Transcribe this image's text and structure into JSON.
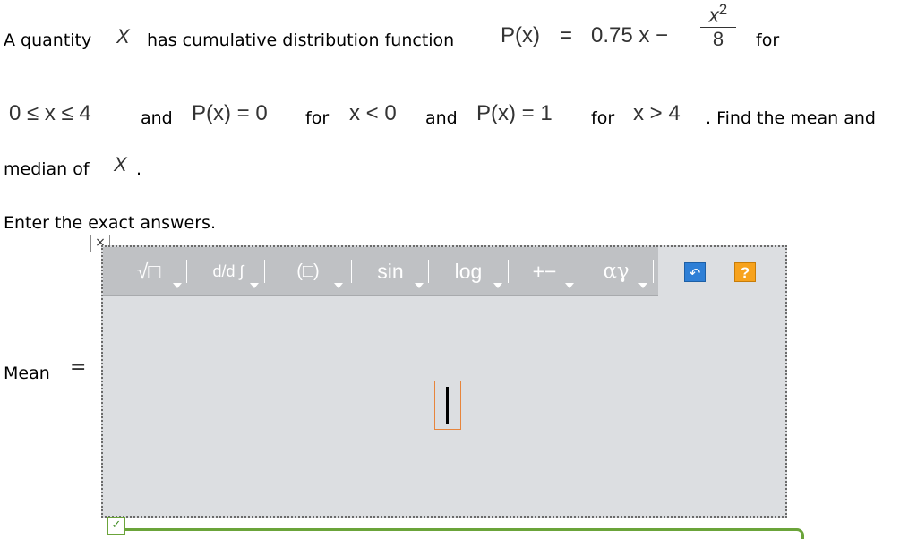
{
  "question": {
    "l1_a": "A quantity",
    "var_x": "X",
    "l1_b": "has cumulative distribution function",
    "cdf_lhs": "P(x)",
    "eq": "=",
    "cdf_rhs": "0.75 x −",
    "frac_num": "x",
    "frac_exp": "2",
    "frac_den": "8",
    "for1": "for",
    "range": "0 ≤ x ≤ 4",
    "and1": "and",
    "cond2": "P(x) = 0",
    "for2": "for",
    "cond2_range": "x < 0",
    "and2": "and",
    "cond3": "P(x) = 1",
    "for3": "for",
    "cond3_range": "x > 4",
    "l2_end": ". Find the mean and",
    "l3_a": "median of",
    "l3_end": "."
  },
  "instruction": "Enter the exact answers.",
  "answer": {
    "label": "Mean",
    "equals": "="
  },
  "editor": {
    "close_glyph": "×",
    "toolbar": [
      {
        "name": "radical-button",
        "label": "√□"
      },
      {
        "name": "calculus-button",
        "label": "d/d ∫"
      },
      {
        "name": "parentheses-button",
        "label": "(□)"
      },
      {
        "name": "trig-button",
        "label": "sin"
      },
      {
        "name": "log-button",
        "label": "log"
      },
      {
        "name": "operators-button",
        "label": "+−"
      },
      {
        "name": "greek-button",
        "label": "αγ"
      }
    ],
    "undo_glyph": "↶",
    "help_glyph": "?",
    "check_glyph": "✓"
  },
  "colors": {
    "toolbar_bg": "#bfc1c4",
    "editor_bg": "#dcdee1",
    "undo_btn": "#2e7fd6",
    "help_btn": "#f7a21c",
    "input_border": "#e7843b",
    "check_green": "#6ba43a"
  }
}
